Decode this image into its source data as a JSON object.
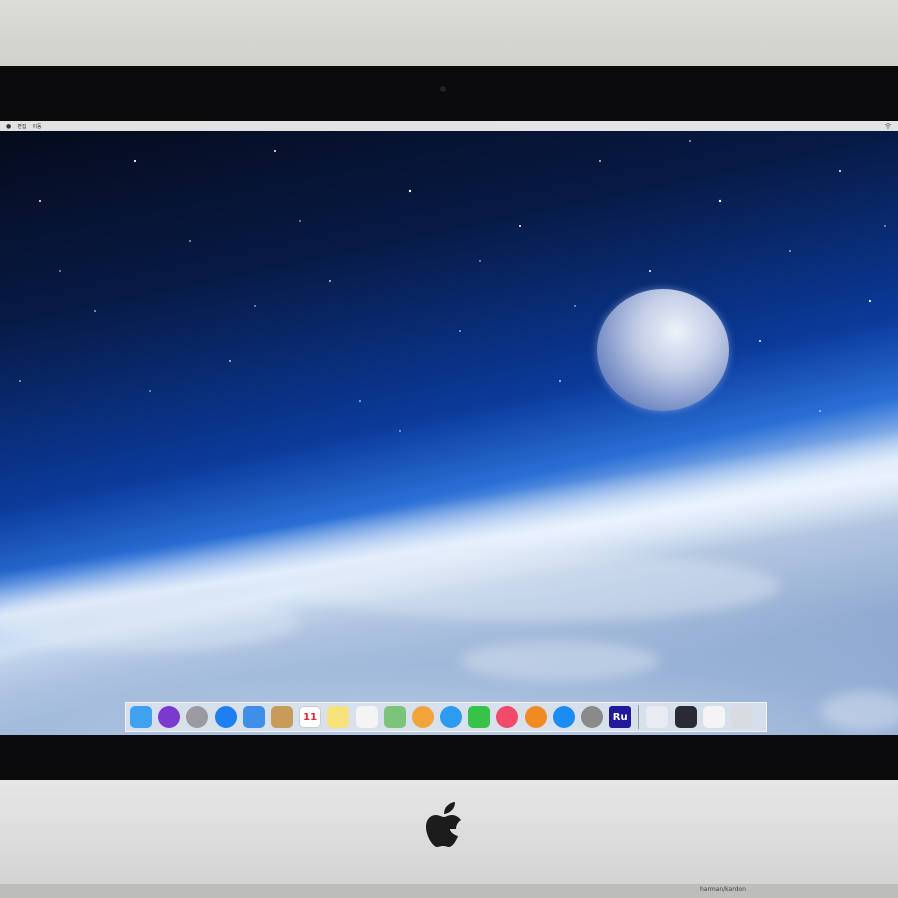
{
  "menubar": {
    "items": [
      "",
      "편집",
      "이동"
    ]
  },
  "desktop": {
    "wallpaper": "earth-from-space-with-moon"
  },
  "dock": {
    "apps": [
      {
        "name": "finder-icon",
        "label": "",
        "color": "#3fa2f0"
      },
      {
        "name": "siri-icon",
        "label": "",
        "color": "#7a3ad0"
      },
      {
        "name": "launchpad-icon",
        "label": "",
        "color": "#9a9aa0"
      },
      {
        "name": "safari-icon",
        "label": "",
        "color": "#1d7ff0"
      },
      {
        "name": "mail-icon",
        "label": "",
        "color": "#3f8fe6"
      },
      {
        "name": "contacts-icon",
        "label": "",
        "color": "#c79b5a"
      },
      {
        "name": "calendar-icon",
        "label": "11",
        "color": "#ffffff"
      },
      {
        "name": "notes-icon",
        "label": "",
        "color": "#f6e27a"
      },
      {
        "name": "reminders-icon",
        "label": "",
        "color": "#f4f4f4"
      },
      {
        "name": "maps-icon",
        "label": "",
        "color": "#7cc47c"
      },
      {
        "name": "photos-icon",
        "label": "",
        "color": "#f2a33a"
      },
      {
        "name": "messages-icon",
        "label": "",
        "color": "#2d9bf0"
      },
      {
        "name": "facetime-icon",
        "label": "",
        "color": "#37c24a"
      },
      {
        "name": "music-icon",
        "label": "",
        "color": "#f14a6a"
      },
      {
        "name": "books-icon",
        "label": "",
        "color": "#f08a22"
      },
      {
        "name": "app-store-icon",
        "label": "",
        "color": "#1c8cf5"
      },
      {
        "name": "system-preferences-icon",
        "label": "",
        "color": "#8a8a8a"
      },
      {
        "name": "adobe-rush-icon",
        "label": "Ru",
        "color": "#1f1a9c"
      }
    ],
    "others": [
      {
        "name": "downloads-folder-icon",
        "label": "",
        "color": "#e8ecf2"
      },
      {
        "name": "desktop-stack-icon",
        "label": "",
        "color": "#2a2a34"
      },
      {
        "name": "document-icon",
        "label": "",
        "color": "#f4f4f4"
      },
      {
        "name": "trash-icon",
        "label": "",
        "color": "#d8dbe0"
      }
    ]
  },
  "desk": {
    "label": "harman/kardon"
  }
}
